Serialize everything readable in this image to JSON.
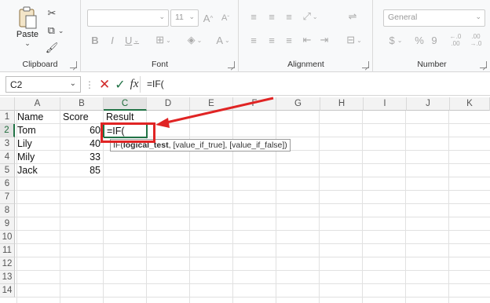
{
  "ribbon": {
    "clipboard": {
      "label": "Clipboard",
      "paste_label": "Paste"
    },
    "font": {
      "label": "Font",
      "font_name": "",
      "font_size": "11"
    },
    "alignment": {
      "label": "Alignment"
    },
    "number": {
      "label": "Number",
      "format": "General",
      "decimal_inc": "←.0 .00",
      "decimal_dec": ".00 →.0"
    }
  },
  "formula_bar": {
    "name_box": "C2",
    "formula": "=IF("
  },
  "grid": {
    "columns": [
      "A",
      "B",
      "C",
      "D",
      "E",
      "F",
      "G",
      "H",
      "I",
      "J",
      "K"
    ],
    "rows": [
      "1",
      "2",
      "3",
      "4",
      "5",
      "6",
      "7",
      "8",
      "9",
      "10",
      "11",
      "12",
      "13",
      "14"
    ],
    "cells": {
      "A1": "Name",
      "B1": "Score",
      "C1": "Result",
      "A2": "Tom",
      "B2": "60",
      "C2": "=IF(",
      "A3": "Lily",
      "B3": "40",
      "A4": "Mily",
      "B4": "33",
      "A5": "Jack",
      "B5": "85"
    }
  },
  "tooltip": {
    "fn": "IF(",
    "arg1": "logical_test",
    "rest": ", [value_if_true], [value_if_false])"
  },
  "colors": {
    "accent": "#217346",
    "annotation": "#e02424"
  }
}
